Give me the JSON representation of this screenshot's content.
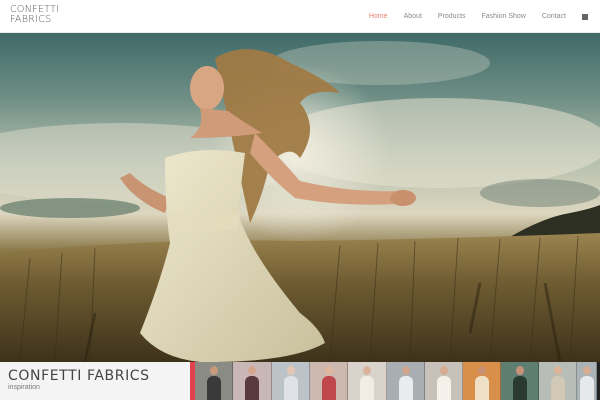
{
  "brand": {
    "logo_line1": "CONFETTI",
    "logo_line2": "FABRICS"
  },
  "nav": {
    "items": [
      {
        "label": "Home",
        "active": true
      },
      {
        "label": "About",
        "active": false
      },
      {
        "label": "Products",
        "active": false
      },
      {
        "label": "Fashion Show",
        "active": false
      },
      {
        "label": "Contact",
        "active": false
      }
    ],
    "menu_icon": "square-menu-icon"
  },
  "hero": {
    "image": "woman-running-in-wheat-field"
  },
  "caption": {
    "title": "CONFETTI FABRICS",
    "subtitle": "inspiration"
  },
  "colors": {
    "accent": "#e2424d",
    "nav_active": "#e98379",
    "nav_text": "#8a8a8a",
    "caption_bg": "#f4f4f4"
  },
  "thumbnails": [
    {
      "name": "thumb-1",
      "bg": "#8b8b86",
      "skin": "#c79a7b",
      "dress": "#3a3a3a"
    },
    {
      "name": "thumb-2",
      "bg": "#c9b7b8",
      "skin": "#d4a68e",
      "dress": "#5a3a3e"
    },
    {
      "name": "thumb-3",
      "bg": "#bcc3c8",
      "skin": "#e3c7b2",
      "dress": "#dfe2e6"
    },
    {
      "name": "thumb-4",
      "bg": "#cdb8b0",
      "skin": "#e0b79f",
      "dress": "#c0474b"
    },
    {
      "name": "thumb-5",
      "bg": "#d9d3cc",
      "skin": "#d9b39c",
      "dress": "#f2ece4"
    },
    {
      "name": "thumb-6",
      "bg": "#a8aeb2",
      "skin": "#cfa58c",
      "dress": "#e9ecef"
    },
    {
      "name": "thumb-7",
      "bg": "#c7c1b9",
      "skin": "#d6ab90",
      "dress": "#f5f1ea"
    },
    {
      "name": "thumb-8",
      "bg": "#d78f4a",
      "skin": "#c99073",
      "dress": "#f0e0c8"
    },
    {
      "name": "thumb-9",
      "bg": "#5f7e72",
      "skin": "#c9937a",
      "dress": "#2b3b34"
    },
    {
      "name": "thumb-10",
      "bg": "#b9bdb7",
      "skin": "#ddb59b",
      "dress": "#d2c8b6"
    },
    {
      "name": "thumb-11",
      "bg": "#aab3b7",
      "skin": "#d5ad95",
      "dress": "#e6e8e9"
    }
  ]
}
